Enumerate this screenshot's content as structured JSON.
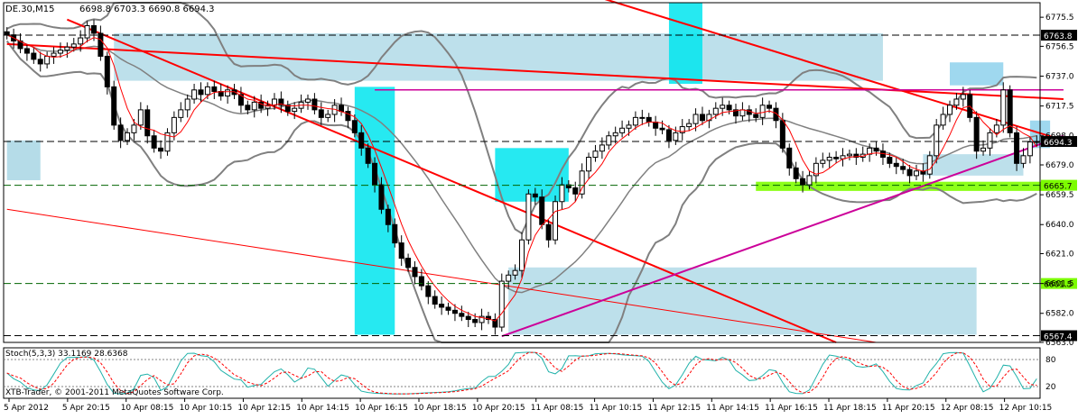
{
  "chart_data": {
    "type": "candlestick",
    "symbol_header": "DE.30,M15",
    "ohlc_header": "6698.8 6703.3 6690.8 6694.3",
    "copyright": "XTB-Trader, © 2001-2011 MetaQuotes Software Corp.",
    "y_ticks": [
      "6775.5",
      "6756.5",
      "6737.0",
      "6717.5",
      "6698.0",
      "6679.0",
      "6659.5",
      "6640.0",
      "6621.0",
      "6601.5",
      "6582.0",
      "6563.0"
    ],
    "y_range": [
      6563,
      6785
    ],
    "x_labels": [
      "5 Apr 2012",
      "5 Apr 20:15",
      "10 Apr 08:15",
      "10 Apr 10:15",
      "10 Apr 12:15",
      "10 Apr 14:15",
      "10 Apr 16:15",
      "10 Apr 18:15",
      "10 Apr 20:15",
      "11 Apr 08:15",
      "11 Apr 10:15",
      "11 Apr 12:15",
      "11 Apr 14:15",
      "11 Apr 16:15",
      "11 Apr 18:15",
      "11 Apr 20:15",
      "12 Apr 08:15",
      "12 Apr 10:15"
    ],
    "price_markers": [
      {
        "label": "6763.8",
        "value": 6763.8,
        "style": "dark"
      },
      {
        "label": "6694.3",
        "value": 6694.3,
        "style": "dark"
      },
      {
        "label": "6665.7",
        "value": 6665.7,
        "style": "green"
      },
      {
        "label": "6601.5",
        "value": 6601.5,
        "style": "green"
      },
      {
        "label": "6567.4",
        "value": 6567.4,
        "style": "dark"
      }
    ],
    "closes": [
      6764,
      6760,
      6755,
      6752,
      6748,
      6745,
      6750,
      6752,
      6754,
      6756,
      6758,
      6762,
      6770,
      6765,
      6750,
      6730,
      6705,
      6695,
      6700,
      6705,
      6715,
      6698,
      6690,
      6688,
      6700,
      6710,
      6715,
      6722,
      6728,
      6725,
      6730,
      6727,
      6724,
      6728,
      6725,
      6718,
      6715,
      6720,
      6716,
      6718,
      6722,
      6718,
      6714,
      6716,
      6720,
      6722,
      6715,
      6710,
      6712,
      6718,
      6714,
      6708,
      6700,
      6690,
      6680,
      6666,
      6650,
      6640,
      6628,
      6618,
      6612,
      6606,
      6600,
      6593,
      6588,
      6586,
      6584,
      6582,
      6580,
      6578,
      6576,
      6580,
      6578,
      6573,
      6603,
      6607,
      6610,
      6630,
      6660,
      6658,
      6640,
      6630,
      6655,
      6666,
      6664,
      6660,
      6675,
      6684,
      6688,
      6692,
      6698,
      6700,
      6703,
      6705,
      6710,
      6710,
      6707,
      6703,
      6702,
      6695,
      6700,
      6704,
      6706,
      6712,
      6708,
      6712,
      6716,
      6718,
      6715,
      6711,
      6715,
      6712,
      6710,
      6718,
      6716,
      6708,
      6690,
      6677,
      6670,
      6666,
      6672,
      6680,
      6682,
      6684,
      6683,
      6685,
      6686,
      6684,
      6686,
      6690,
      6688,
      6684,
      6680,
      6678,
      6676,
      6672,
      6675,
      6673,
      6685,
      6705,
      6712,
      6718,
      6722,
      6725,
      6710,
      6688,
      6690,
      6700,
      6705,
      6728,
      6700,
      6680,
      6685,
      6694,
      6694.3
    ],
    "stoch_ticks": [
      "80",
      "20"
    ],
    "stoch_label": "Stoch(5,3,3) 33.1169 28.6368"
  }
}
